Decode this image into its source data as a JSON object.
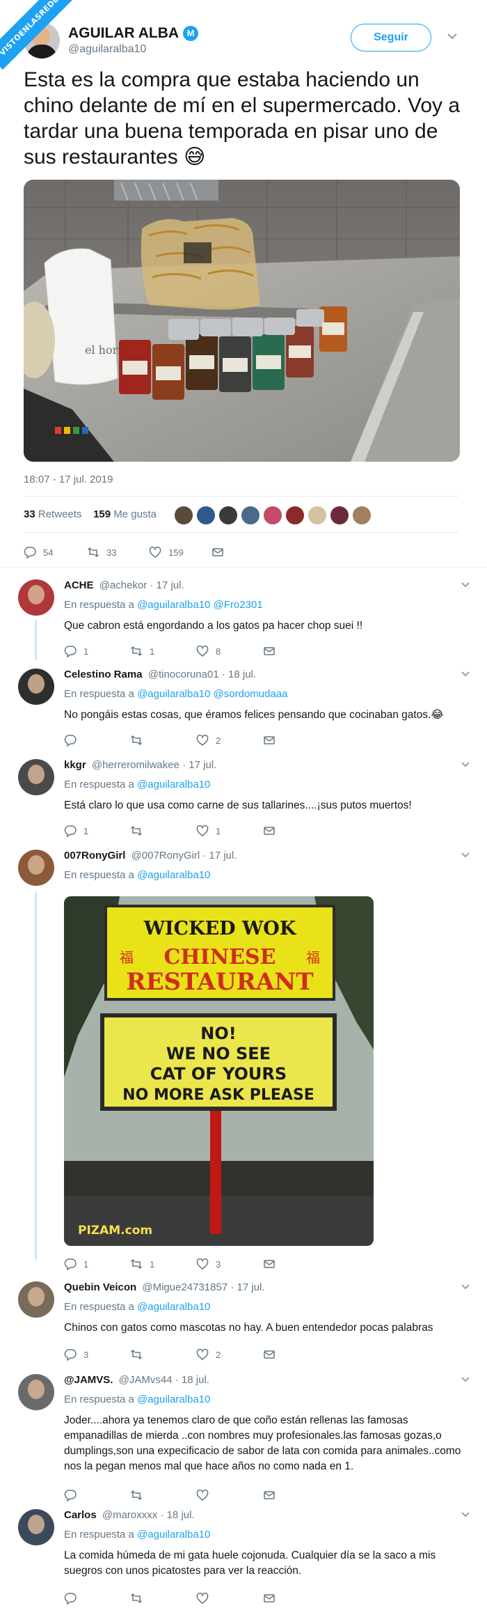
{
  "watermark": "VISTOENLASREDES",
  "tweet": {
    "author_name": "AGUILAR ALBA",
    "verified_glyph": "M",
    "author_handle": "@aguilaralba10",
    "follow_label": "Seguir",
    "text": "Esta es la compra que estaba haciendo un chino delante de mí en el supermercado. Voy a tardar una buena temporada en pisar uno de sus restaurantes 😅",
    "photo_bag_text": "el horno de Mercadona",
    "timestamp": "18:07 - 17 jul. 2019",
    "retweets_count": "33",
    "retweets_label": "Retweets",
    "likes_count": "159",
    "likes_label": "Me gusta",
    "action_counts": {
      "replies": "54",
      "retweets": "33",
      "likes": "159"
    },
    "liker_colors": [
      "#5a4a3a",
      "#2d5a8a",
      "#3a3a3a",
      "#4a6a8a",
      "#c44a6a",
      "#8a2a2a",
      "#d4c2a0",
      "#6a2a3a",
      "#a08060"
    ]
  },
  "replies": [
    {
      "name": "ACHE",
      "handle": "@achekor",
      "date": "· 17 jul.",
      "in_reply_label": "En respuesta a",
      "mentions": "@aguilaralba10 @Fro2301",
      "text": "Que cabron está engordando a los gatos pa hacer chop suei !!",
      "replies": "1",
      "retweets": "1",
      "likes": "8",
      "avatar_color": "#b0383a"
    },
    {
      "name": "Celestino Rama",
      "handle": "@tinocoruna01",
      "date": "· 18 jul.",
      "in_reply_label": "En respuesta a",
      "mentions": "@aguilaralba10 @sordomudaaa",
      "text": "No pongáis estas cosas, que éramos felices pensando que cocinaban gatos.😂",
      "replies": "",
      "retweets": "",
      "likes": "2",
      "avatar_color": "#2e2e2e"
    },
    {
      "name": "kkgr",
      "handle": "@herreromilwakee",
      "date": "· 17 jul.",
      "in_reply_label": "En respuesta a",
      "mentions": "@aguilaralba10",
      "text": "Está claro lo que usa como carne de sus tallarines....¡sus putos muertos!",
      "replies": "1",
      "retweets": "",
      "likes": "1",
      "avatar_color": "#4a4a4a"
    },
    {
      "name": "007RonyGirl",
      "handle": "@007RonyGirl",
      "date": "· 17 jul.",
      "in_reply_label": "En respuesta a",
      "mentions": "@aguilaralba10",
      "text": "",
      "replies": "1",
      "retweets": "1",
      "likes": "3",
      "avatar_color": "#8a5a3a",
      "photo": {
        "sign_top_line1": "WICKED WOK",
        "sign_top_line2": "CHINESE",
        "sign_top_line3": "RESTAURANT",
        "sign_glyph": "福",
        "sign_bottom_line1": "NO!",
        "sign_bottom_line2": "WE NO SEE",
        "sign_bottom_line3": "CAT OF YOURS",
        "sign_bottom_line4": "NO MORE ASK PLEASE",
        "watermark": "PIZAM.com"
      }
    },
    {
      "name": "Quebin Veicon",
      "handle": "@Migue24731857",
      "date": "· 17 jul.",
      "in_reply_label": "En respuesta a",
      "mentions": "@aguilaralba10",
      "text": "Chinos con gatos como mascotas no hay. A buen entendedor pocas palabras",
      "replies": "3",
      "retweets": "",
      "likes": "2",
      "avatar_color": "#7a6a5a"
    },
    {
      "name": "@JAMVS.",
      "handle": "@JAMvs44",
      "date": "· 18 jul.",
      "in_reply_label": "En respuesta a",
      "mentions": "@aguilaralba10",
      "text": "Joder....ahora ya tenemos claro de que coño están rellenas las famosas empanadillas de mierda ..con nombres muy profesionales.las famosas gozas,o dumplings,son una expecificacio de sabor de lata  con comida para animales..como nos la pegan menos mal que hace años no como nada en 1.",
      "replies": "",
      "retweets": "",
      "likes": "",
      "avatar_color": "#6a6a6a"
    },
    {
      "name": "Carlos",
      "handle": "@maroxxxx",
      "date": "· 18 jul.",
      "in_reply_label": "En respuesta a",
      "mentions": "@aguilaralba10",
      "text": "La comida húmeda de mi gata huele cojonuda. Cualquier día se la saco a mis suegros con unos picatostes para ver la reacción.",
      "replies": "",
      "retweets": "",
      "likes": "",
      "avatar_color": "#3a4a5a"
    }
  ]
}
